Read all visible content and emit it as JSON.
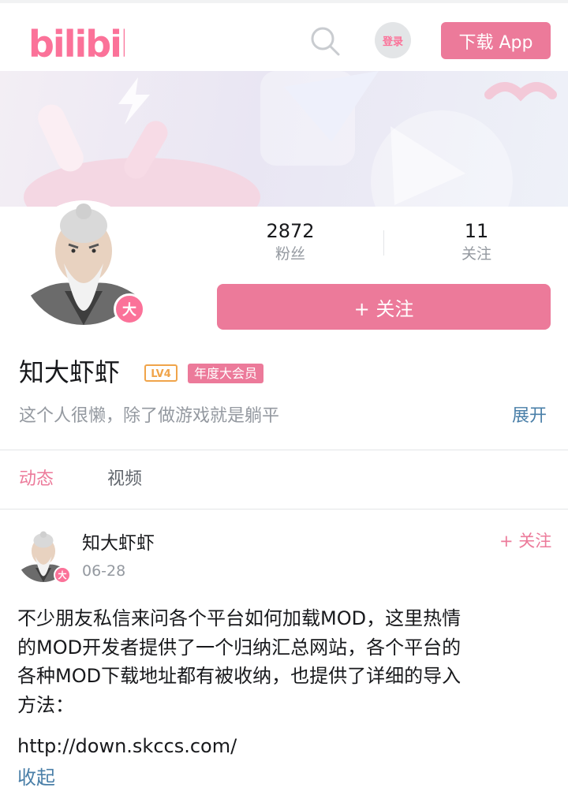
{
  "header": {
    "logo_text": "bilibili",
    "login_label": "登录",
    "download_label": "下载 App"
  },
  "profile": {
    "fans_count": "2872",
    "fans_label": "粉丝",
    "following_count": "11",
    "following_label": "关注",
    "follow_button": "+ 关注",
    "avatar_badge": "大",
    "username": "知大虾虾",
    "level_badge": "LV4",
    "vip_badge": "年度大会员",
    "bio": "这个人很懒，除了做游戏就是躺平",
    "expand_label": "展开"
  },
  "tabs": [
    {
      "label": "动态",
      "active": true
    },
    {
      "label": "视频",
      "active": false
    }
  ],
  "post": {
    "author": "知大虾虾",
    "date": "06-28",
    "follow_label": "+ 关注",
    "avatar_badge": "大",
    "lines": [
      "不少朋友私信来问各个平台如何加载MOD，这里热情",
      "的MOD开发者提供了一个归纳汇总网站，各个平台的",
      "各种MOD下载地址都有被收纳，也提供了详细的导入",
      "方法："
    ],
    "link": "http://down.skccs.com/",
    "collapse_label": "收起"
  },
  "colors": {
    "brand_pink": "#fb7299",
    "button_pink": "#ec7a9a",
    "link_blue": "#4a7fa8",
    "muted_gray": "#9499a0"
  },
  "icons": {
    "search": "search-icon",
    "logo": "bilibili-logo"
  }
}
